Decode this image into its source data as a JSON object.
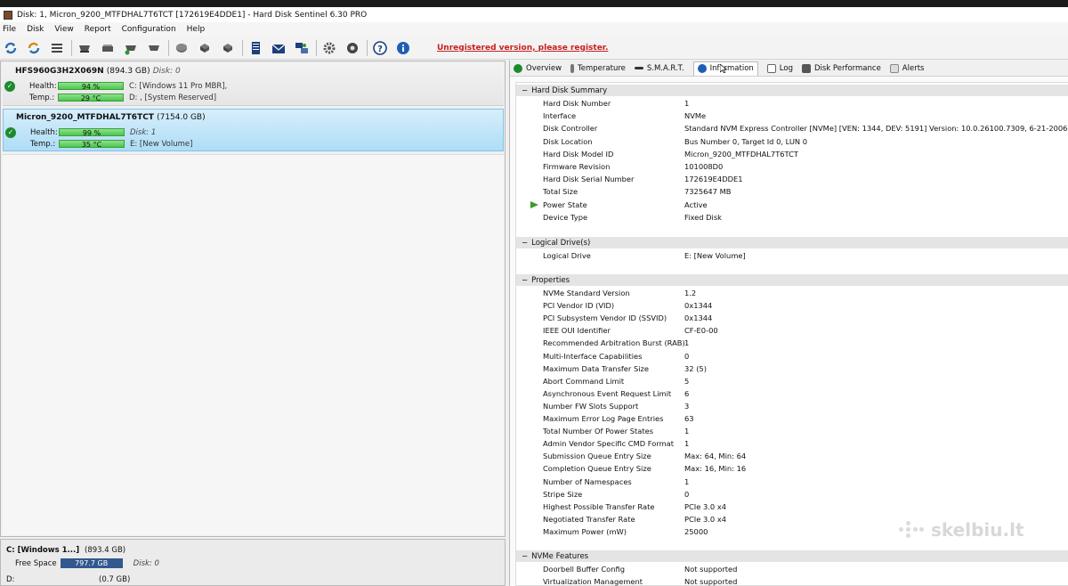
{
  "window": {
    "title": "Disk: 1, Micron_9200_MTFDHAL7T6TCT [172619E4DDE1]  -  Hard Disk Sentinel 6.30 PRO"
  },
  "menu": {
    "items": [
      "File",
      "Disk",
      "View",
      "Report",
      "Configuration",
      "Help"
    ]
  },
  "toolbar": {
    "unregistered": "Unregistered version, please register.",
    "icons": [
      "refresh-icon",
      "refresh-all-icon",
      "list-icon",
      "drive-icon",
      "drive-sync-icon",
      "drive-check-icon",
      "drive-check-2-icon",
      "disk-icon",
      "disk-2-icon",
      "disk-3-icon",
      "report-icon",
      "mail-icon",
      "network-icon",
      "gear-icon",
      "settings-2-icon",
      "help-icon",
      "info-icon"
    ],
    "colors": {
      "refresh": "#2a6db5",
      "drive": "#555555",
      "green": "#2a9a2a",
      "help": "#1e5fb5"
    }
  },
  "disks": [
    {
      "name": "HFS960G3H2X069N",
      "size": "(894.3 GB)",
      "disk": "Disk: 0",
      "health_label": "Health:",
      "health": "94 %",
      "temp_label": "Temp.:",
      "temp": "29 °C",
      "vol1": "C: [Windows 11 Pro MBR],",
      "vol2": "D: , [System Reserved]"
    },
    {
      "name": "Micron_9200_MTFDHAL7T6TCT",
      "size": "(7154.0 GB)",
      "disk": "Disk: 1",
      "health_label": "Health:",
      "health": "99 %",
      "temp_label": "Temp.:",
      "temp": "35 °C",
      "vol1": "Disk: 1",
      "vol2": "E: [New Volume]"
    }
  ],
  "partitions": {
    "p1_name": "C: [Windows 1...]",
    "p1_size": "(893.4 GB)",
    "free_label": "Free Space",
    "free": "797.7 GB",
    "p1_disk": "Disk: 0",
    "p2_name": "D:",
    "p2_size": "(0.7 GB)"
  },
  "tabs": [
    "Overview",
    "Temperature",
    "S.M.A.R.T.",
    "Information",
    "Log",
    "Disk Performance",
    "Alerts"
  ],
  "sections": {
    "summary": "Hard Disk Summary",
    "logical": "Logical Drive(s)",
    "properties": "Properties",
    "nvme": "NVMe Features"
  },
  "summary_rows": [
    {
      "k": "Hard Disk Number",
      "v": "1"
    },
    {
      "k": "Interface",
      "v": "NVMe"
    },
    {
      "k": "Disk Controller",
      "v": "Standard NVM Express Controller [NVMe] [VEN: 1344, DEV: 5191] Version: 10.0.26100.7309, 6-21-2006"
    },
    {
      "k": "Disk Location",
      "v": "Bus Number 0, Target Id 0, LUN 0"
    },
    {
      "k": "Hard Disk Model ID",
      "v": "Micron_9200_MTFDHAL7T6TCT"
    },
    {
      "k": "Firmware Revision",
      "v": "101008D0"
    },
    {
      "k": "Hard Disk Serial Number",
      "v": "172619E4DDE1"
    },
    {
      "k": "Total Size",
      "v": "7325647 MB"
    },
    {
      "k": "Power State",
      "v": "Active"
    },
    {
      "k": "Device Type",
      "v": "Fixed Disk"
    }
  ],
  "logical_rows": [
    {
      "k": "Logical Drive",
      "v": "E: [New Volume]"
    }
  ],
  "property_rows": [
    {
      "k": "NVMe Standard Version",
      "v": "1.2"
    },
    {
      "k": "PCI Vendor ID (VID)",
      "v": "0x1344"
    },
    {
      "k": "PCI Subsystem Vendor ID (SSVID)",
      "v": "0x1344"
    },
    {
      "k": "IEEE OUI Identifier",
      "v": "CF-E0-00"
    },
    {
      "k": "Recommended Arbitration Burst (RAB)",
      "v": "1"
    },
    {
      "k": "Multi-Interface Capabilities",
      "v": "0"
    },
    {
      "k": "Maximum Data Transfer Size",
      "v": "32 (5)"
    },
    {
      "k": "Abort Command Limit",
      "v": "5"
    },
    {
      "k": "Asynchronous Event Request Limit",
      "v": "6"
    },
    {
      "k": "Number FW Slots Support",
      "v": "3"
    },
    {
      "k": "Maximum Error Log Page Entries",
      "v": "63"
    },
    {
      "k": "Total Number Of Power States",
      "v": "1"
    },
    {
      "k": "Admin Vendor Specific CMD Format",
      "v": "1"
    },
    {
      "k": "Submission Queue Entry Size",
      "v": "Max: 64, Min: 64"
    },
    {
      "k": "Completion Queue Entry Size",
      "v": "Max: 16, Min: 16"
    },
    {
      "k": "Number of Namespaces",
      "v": "1"
    },
    {
      "k": "Stripe Size",
      "v": "0"
    },
    {
      "k": "Highest Possible Transfer Rate",
      "v": "PCIe 3.0 x4"
    },
    {
      "k": "Negotiated Transfer Rate",
      "v": "PCIe 3.0 x4"
    },
    {
      "k": "Maximum Power (mW)",
      "v": "25000"
    }
  ],
  "nvme_rows": [
    {
      "k": "Doorbell Buffer Config",
      "v": "Not supported"
    },
    {
      "k": "Virtualization Management",
      "v": "Not supported"
    }
  ],
  "watermark": "skelbiu.lt"
}
